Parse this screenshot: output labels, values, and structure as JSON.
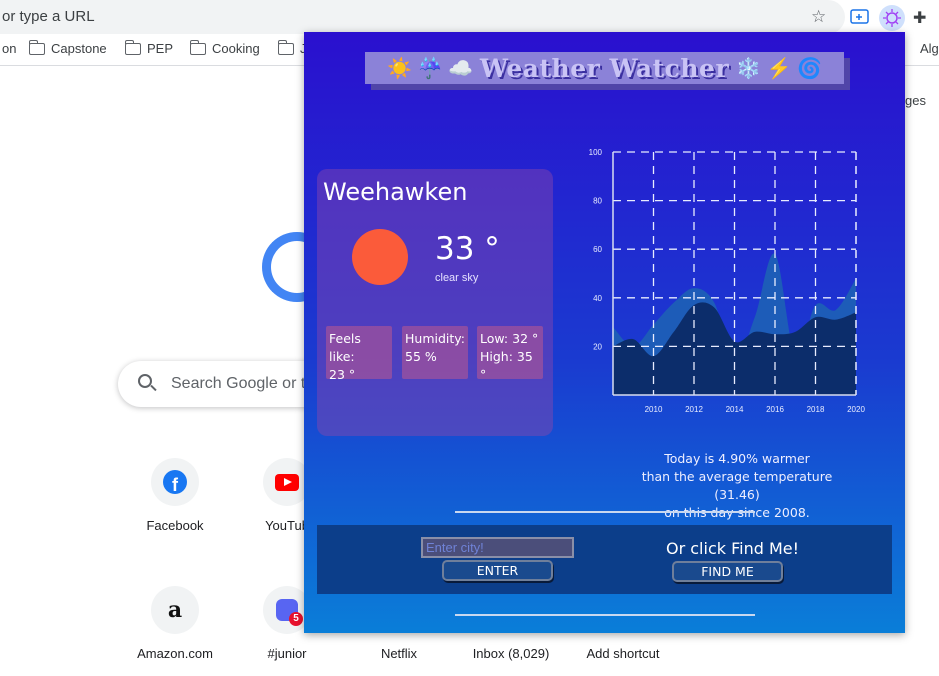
{
  "browser": {
    "url_placeholder": "or type a URL",
    "bookmarks": [
      {
        "label": "on"
      },
      {
        "label": "Capstone"
      },
      {
        "label": "PEP"
      },
      {
        "label": "Cooking"
      },
      {
        "label": "J"
      },
      {
        "label": "Alg"
      }
    ],
    "ntp_side_text": "ges"
  },
  "ntp": {
    "search_placeholder": "Search Google or t",
    "tiles": [
      {
        "label": "Facebook"
      },
      {
        "label": "YouTub"
      },
      {
        "label": "Amazon.com"
      },
      {
        "label": "#junior",
        "badge": "5"
      },
      {
        "label": "Netflix"
      },
      {
        "label": "Inbox (8,029)"
      },
      {
        "label": "Add shortcut"
      }
    ]
  },
  "popup": {
    "title_icons_left": "☀️ ☔ ☁️",
    "title": "Weather Watcher",
    "title_icons_right": "❄️ ⚡ 🌀",
    "weather": {
      "city": "Weehawken",
      "temperature": "33 °",
      "description": "clear sky",
      "feels_like_label": "Feels like:",
      "feels_like_value": "23 °",
      "humidity_label": "Humidity:",
      "humidity_value": "55 %",
      "low": "Low: 32 °",
      "high": "High: 35 °"
    },
    "comparison": {
      "line1": "Today is 4.90% warmer",
      "line2": "than the average temperature (31.46)",
      "line3": "on this day since 2008."
    },
    "controls": {
      "city_placeholder": "Enter city!",
      "enter_label": "ENTER",
      "find_prompt": "Or click Find Me!",
      "find_label": "FIND ME"
    }
  },
  "chart_data": {
    "type": "area",
    "x": [
      2008,
      2009,
      2010,
      2011,
      2012,
      2013,
      2014,
      2015,
      2016,
      2017,
      2018,
      2019,
      2020
    ],
    "series": [
      {
        "values": [
          28,
          20,
          29,
          38,
          44,
          38,
          14,
          32,
          58,
          16,
          37,
          35,
          48
        ],
        "color": "#1d5cb8"
      },
      {
        "values": [
          20,
          23,
          16,
          26,
          37,
          36,
          22,
          26,
          25,
          26,
          32,
          31,
          34
        ],
        "color": "#0c2d6b"
      }
    ],
    "x_ticks": [
      2010,
      2012,
      2014,
      2016,
      2018,
      2020
    ],
    "y_ticks": [
      20,
      40,
      60,
      80,
      100
    ],
    "xlim": [
      2008,
      2020
    ],
    "ylim": [
      0,
      100
    ],
    "grid": true
  }
}
